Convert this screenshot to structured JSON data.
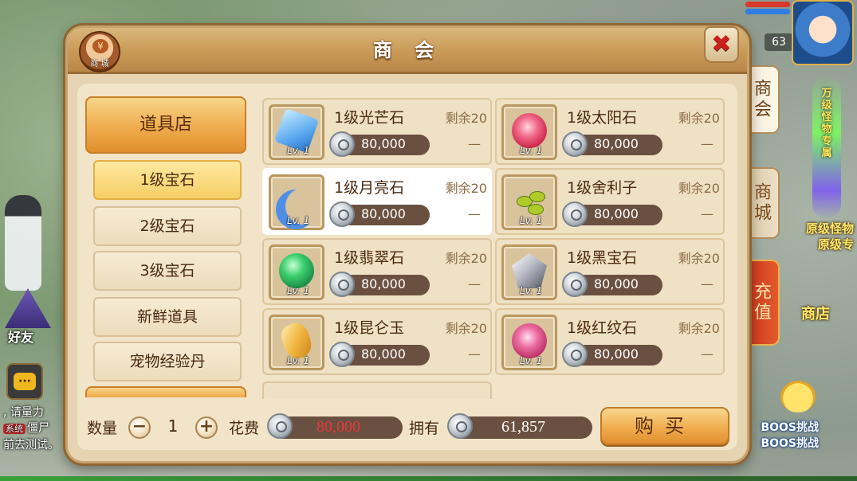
{
  "hud": {
    "level": "63",
    "friend_label": "好友",
    "chat_icon": "···",
    "sys_tag": "系统",
    "sys_lines": [
      ", 请量力",
      "僵尸",
      "前去测试。"
    ],
    "pillar_text": "万级怪物专属",
    "scene_text_right_1": "原级怪物",
    "scene_text_right_2": "原级专",
    "scene_text_shop": "商店",
    "boss_text_1": "BOOS挑战",
    "boss_text_2": "BOOS挑战"
  },
  "side_tabs": [
    {
      "label": "商会",
      "active": true
    },
    {
      "label": "商城",
      "active": false
    },
    {
      "label": "充值",
      "active": false
    }
  ],
  "panel": {
    "title": "商 会",
    "badge_label": "商 城",
    "badge_coin": "¥",
    "close_icon": "✖"
  },
  "categories": {
    "main": "道具店",
    "items": [
      {
        "label": "1级宝石",
        "active": true
      },
      {
        "label": "2级宝石",
        "active": false
      },
      {
        "label": "3级宝石",
        "active": false
      },
      {
        "label": "新鲜道具",
        "active": false
      },
      {
        "label": "宠物经验丹",
        "active": false
      }
    ]
  },
  "goods": [
    {
      "name": "1级光芒石",
      "remain": "剩余20",
      "price": "80,000",
      "lv": "Lv. 1",
      "dash": "—",
      "icon": "blue-crystal-icon",
      "color": "#5aa8f0",
      "selected": false
    },
    {
      "name": "1级太阳石",
      "remain": "剩余20",
      "price": "80,000",
      "lv": "Lv. 1",
      "dash": "—",
      "icon": "sun-stone-icon",
      "color": "#e8426a",
      "selected": false
    },
    {
      "name": "1级月亮石",
      "remain": "剩余20",
      "price": "80,000",
      "lv": "Lv. 1",
      "dash": "—",
      "icon": "moon-stone-icon",
      "color": "#4f8ee6",
      "selected": true
    },
    {
      "name": "1级舍利子",
      "remain": "剩余20",
      "price": "80,000",
      "lv": "Lv. 1",
      "dash": "—",
      "icon": "sarira-icon",
      "color": "#aecb2a",
      "selected": false
    },
    {
      "name": "1级翡翠石",
      "remain": "剩余20",
      "price": "80,000",
      "lv": "Lv. 1",
      "dash": "—",
      "icon": "emerald-icon",
      "color": "#2fae5a",
      "selected": false
    },
    {
      "name": "1级黑宝石",
      "remain": "剩余20",
      "price": "80,000",
      "lv": "Lv. 1",
      "dash": "—",
      "icon": "black-gem-icon",
      "color": "#b9bcc6",
      "selected": false
    },
    {
      "name": "1级昆仑玉",
      "remain": "剩余20",
      "price": "80,000",
      "lv": "Lv. 1",
      "dash": "—",
      "icon": "kunlun-jade-icon",
      "color": "#f2b640",
      "selected": false
    },
    {
      "name": "1级红纹石",
      "remain": "剩余20",
      "price": "80,000",
      "lv": "Lv. 1",
      "dash": "—",
      "icon": "red-vein-stone-icon",
      "color": "#e0457a",
      "selected": false
    }
  ],
  "footer": {
    "qty_label": "数量",
    "qty_minus": "−",
    "qty_value": "1",
    "qty_plus": "+",
    "cost_label": "花费",
    "cost_value": "80,000",
    "cost_color": "#e8383a",
    "own_label": "拥有",
    "own_value": "61,857",
    "buy_label": "购买"
  }
}
